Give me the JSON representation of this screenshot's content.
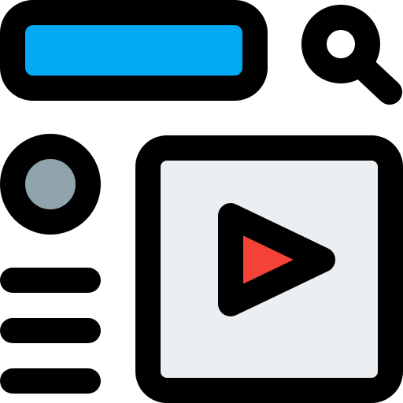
{
  "icon": {
    "name": "video-web-page-icon",
    "parts": {
      "search_bar": {
        "name": "search-bar",
        "fill": "#03a9f4"
      },
      "search_button": {
        "name": "search-icon"
      },
      "avatar": {
        "name": "avatar",
        "fill": "#90a4ae"
      },
      "text_lines": {
        "name": "text-lines",
        "count": 3
      },
      "video_player": {
        "name": "video-player",
        "fill": "#eceff1"
      },
      "play_button": {
        "name": "play-icon",
        "fill": "#f44336"
      }
    },
    "colors": {
      "outline": "#000000",
      "background": "#ffffff"
    }
  }
}
